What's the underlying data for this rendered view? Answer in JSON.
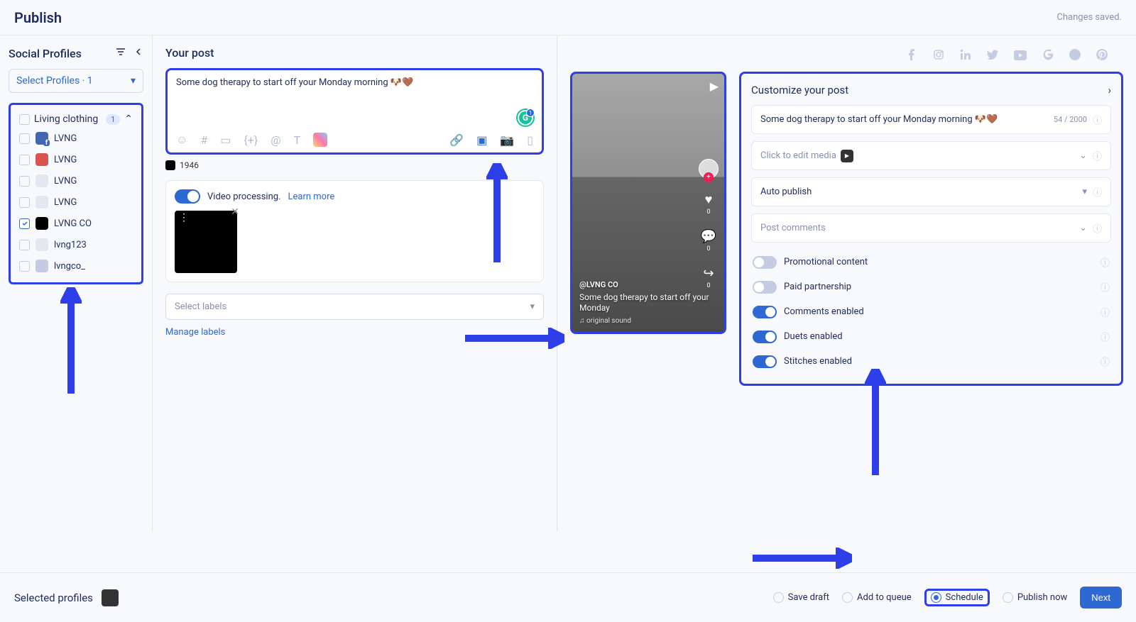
{
  "header": {
    "title": "Publish",
    "status": "Changes saved."
  },
  "sidebar": {
    "title": "Social Profiles",
    "select_label": "Select Profiles · 1",
    "group_name": "Living clothing",
    "group_count": "1",
    "items": [
      {
        "label": "LVNG",
        "checked": false,
        "avatar": "fb"
      },
      {
        "label": "LVNG",
        "checked": false,
        "avatar": "li"
      },
      {
        "label": "LVNG",
        "checked": false,
        "avatar": "tw"
      },
      {
        "label": "LVNG",
        "checked": false,
        "avatar": "gg"
      },
      {
        "label": "LVNG CO",
        "checked": true,
        "avatar": "tk"
      },
      {
        "label": "lvng123",
        "checked": false,
        "avatar": "ig"
      },
      {
        "label": "lvngco_",
        "checked": false,
        "avatar": "generic"
      }
    ]
  },
  "compose": {
    "title": "Your post",
    "text": "Some dog therapy to start off your Monday morning 🐶🤎",
    "grammarly_count": "1",
    "char_count": "1946",
    "video_processing": "Video processing.",
    "learn_more": "Learn more",
    "labels_placeholder": "Select labels",
    "manage_labels": "Manage labels"
  },
  "preview": {
    "user": "@LVNG CO",
    "caption": "Some dog therapy to start off your Monday",
    "sound": "♫  original sound",
    "actions": {
      "likes": "0",
      "comments": "0",
      "shares": "0"
    }
  },
  "customize": {
    "title": "Customize your post",
    "caption": "Some dog therapy to start off your Monday morning 🐶🤎",
    "char_count": "54 / 2000",
    "media_label": "Click to edit media",
    "publish_type": "Auto publish",
    "comments_label": "Post comments",
    "settings": [
      {
        "label": "Promotional content",
        "on": false
      },
      {
        "label": "Paid partnership",
        "on": false
      },
      {
        "label": "Comments enabled",
        "on": true
      },
      {
        "label": "Duets enabled",
        "on": true
      },
      {
        "label": "Stitches enabled",
        "on": true
      }
    ]
  },
  "footer": {
    "label": "Selected profiles",
    "options": [
      {
        "label": "Save draft",
        "checked": false
      },
      {
        "label": "Add to queue",
        "checked": false
      },
      {
        "label": "Schedule",
        "checked": true
      },
      {
        "label": "Publish now",
        "checked": false
      }
    ],
    "next": "Next"
  }
}
